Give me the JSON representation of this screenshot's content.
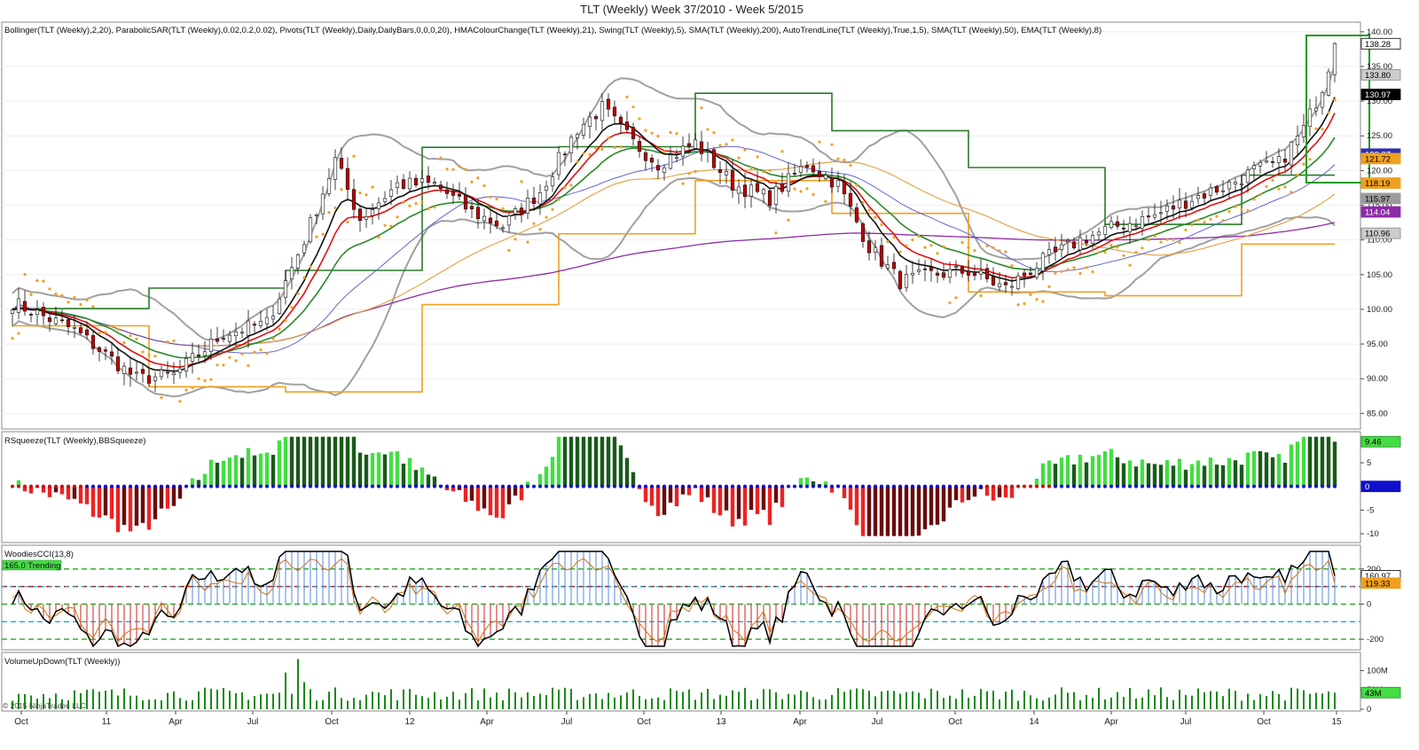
{
  "page": {
    "title": "TLT (Weekly)  Week 37/2010 - Week 5/2015",
    "copyright": "© 2015 NinjaTrader, LLC"
  },
  "colors": {
    "up_candle": "#ffffff",
    "down_candle": "#c00000",
    "bollinger": "#a0a0a0",
    "psar": "#f0a020",
    "pivots_resistance": "#2a7a2a",
    "pivots_support": "#f0a020",
    "hma": "#e01010",
    "sma200": "#8c2aa6",
    "sma50": "#e0a040",
    "ema8": "#111111",
    "ema21": "#2a8a2a",
    "squeeze_pos_bright": "#44dd44",
    "squeeze_pos_dark": "#1a5a1a",
    "squeeze_neg_bright": "#ee2222",
    "squeeze_neg_dark": "#6a0a0a",
    "squeeze_dot_blue": "#1010cc",
    "squeeze_dot_red": "#cc1010",
    "volume": "#1a8a1a",
    "cci_main": "#000000",
    "cci_turbo": "#d07010"
  },
  "panels": {
    "price": {
      "indicators_label": "Bollinger(TLT (Weekly),2,20), ParabolicSAR(TLT (Weekly),0.02,0.2,0.02), Pivots(TLT (Weekly),Daily,DailyBars,0,0,0,20), HMAColourChange(TLT (Weekly),21), Swing(TLT (Weekly),5), SMA(TLT (Weekly),200), AutoTrendLine(TLT (Weekly),True,1,5), SMA(TLT (Weekly),50), EMA(TLT (Weekly),8)",
      "y_ticks": [
        "140.00",
        "135.00",
        "130.00",
        "125.00",
        "120.00",
        "115.00",
        "110.00",
        "105.00",
        "100.00",
        "95.00",
        "90.00",
        "85.00"
      ],
      "tags": [
        {
          "value": "138.28",
          "bg": "#ffffff",
          "fg": "#000000",
          "border": "#000000"
        },
        {
          "value": "133.80",
          "bg": "#cccccc",
          "fg": "#000000",
          "border": "#888888"
        },
        {
          "value": "130.97",
          "bg": "#000000",
          "fg": "#ffffff",
          "border": "#000000"
        },
        {
          "value": "122.37",
          "bg": "#3030b0",
          "fg": "#ffffff",
          "border": "#3030b0"
        },
        {
          "value": "121.72",
          "bg": "#f0a020",
          "fg": "#000000",
          "border": "#f0a020"
        },
        {
          "value": "118.19",
          "bg": "#f0a020",
          "fg": "#000000",
          "border": "#f0a020"
        },
        {
          "value": "115.97",
          "bg": "#9b9b9b",
          "fg": "#000000",
          "border": "#9b9b9b"
        },
        {
          "value": "114.04",
          "bg": "#8c2aa6",
          "fg": "#ffffff",
          "border": "#8c2aa6"
        },
        {
          "value": "110.96",
          "bg": "#cccccc",
          "fg": "#000000",
          "border": "#888888"
        }
      ]
    },
    "squeeze": {
      "label": "RSqueeze(TLT (Weekly),BBSqueeze)",
      "y_ticks": [
        "5",
        "0",
        "-5",
        "-10"
      ],
      "tags": [
        {
          "value": "9.46",
          "bg": "#44dd44",
          "fg": "#000000",
          "border": "#2a8a2a"
        },
        {
          "value": "0",
          "bg": "#1010cc",
          "fg": "#ffffff",
          "border": "#1010cc"
        }
      ]
    },
    "cci": {
      "label": "WoodiesCCI(13,8)",
      "badge": "165.0 Trending",
      "y_ticks": [
        "200",
        "0",
        "-200"
      ],
      "tags": [
        {
          "value": "160.97",
          "bg": "#ffffff",
          "fg": "#000000",
          "border": "#000000"
        },
        {
          "value": "119.33",
          "bg": "#f0a020",
          "fg": "#000000",
          "border": "#f0a020"
        }
      ]
    },
    "volume": {
      "label": "VolumeUpDown(TLT (Weekly))",
      "y_ticks": [
        "100M",
        "50M",
        "0"
      ],
      "tags": [
        {
          "value": "43M",
          "bg": "#44dd44",
          "fg": "#000000",
          "border": "#2a8a2a"
        }
      ]
    }
  },
  "chart_data": {
    "type": "candlestick",
    "symbol": "TLT",
    "interval": "Weekly",
    "x_range": [
      "2010 Week 37",
      "2015 Week 5"
    ],
    "x_tick_labels": [
      "Oct",
      "11",
      "Apr",
      "Jul",
      "Oct",
      "12",
      "Apr",
      "Jul",
      "Oct",
      "13",
      "Apr",
      "Jul",
      "Oct",
      "14",
      "Apr",
      "Jul",
      "Oct",
      "15"
    ],
    "ylim": [
      83,
      141
    ],
    "close_anchors": [
      {
        "week": 0,
        "close": 101
      },
      {
        "week": 10,
        "close": 97
      },
      {
        "week": 20,
        "close": 90
      },
      {
        "week": 26,
        "close": 90.5
      },
      {
        "week": 34,
        "close": 96.5
      },
      {
        "week": 41,
        "close": 98
      },
      {
        "week": 47,
        "close": 110
      },
      {
        "week": 52,
        "close": 121.5
      },
      {
        "week": 56,
        "close": 113
      },
      {
        "week": 62,
        "close": 118
      },
      {
        "week": 68,
        "close": 118
      },
      {
        "week": 74,
        "close": 114
      },
      {
        "week": 79,
        "close": 112
      },
      {
        "week": 85,
        "close": 117
      },
      {
        "week": 91,
        "close": 126
      },
      {
        "week": 95,
        "close": 129
      },
      {
        "week": 100,
        "close": 124
      },
      {
        "week": 104,
        "close": 121
      },
      {
        "week": 110,
        "close": 124
      },
      {
        "week": 116,
        "close": 118
      },
      {
        "week": 122,
        "close": 116
      },
      {
        "week": 128,
        "close": 121
      },
      {
        "week": 133,
        "close": 118
      },
      {
        "week": 138,
        "close": 109
      },
      {
        "week": 143,
        "close": 104
      },
      {
        "week": 148,
        "close": 105
      },
      {
        "week": 154,
        "close": 105.5
      },
      {
        "week": 160,
        "close": 103
      },
      {
        "week": 166,
        "close": 107
      },
      {
        "week": 172,
        "close": 110
      },
      {
        "week": 178,
        "close": 112
      },
      {
        "week": 184,
        "close": 113.5
      },
      {
        "week": 190,
        "close": 116
      },
      {
        "week": 196,
        "close": 118
      },
      {
        "week": 200,
        "close": 120
      },
      {
        "week": 204,
        "close": 121
      },
      {
        "week": 208,
        "close": 126
      },
      {
        "week": 211,
        "close": 132
      },
      {
        "week": 213,
        "close": 138.28
      }
    ],
    "last_values": {
      "close": 138.28,
      "bollinger_upper": 133.8,
      "bollinger_lower": 110.96,
      "ema8": 130.97,
      "sma50": 122.37,
      "psar": 121.72,
      "pivot_support": 118.19,
      "sma200": 114.04,
      "squeeze": 9.46,
      "cci": 160.97,
      "cci_turbo": 119.33,
      "volume": "43M"
    }
  }
}
